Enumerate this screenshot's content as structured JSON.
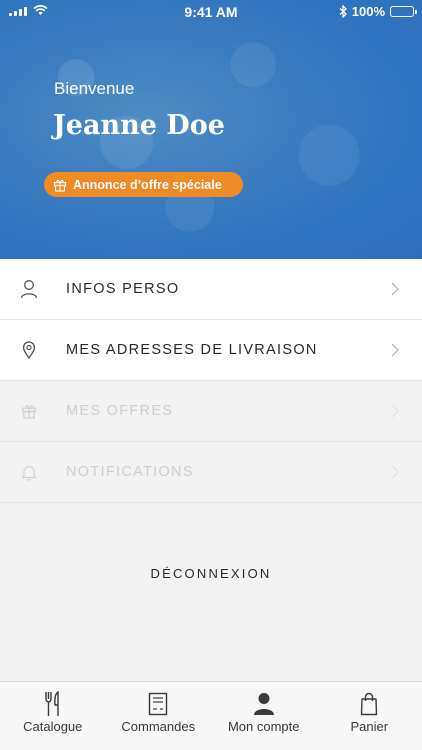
{
  "status_bar": {
    "time": "9:41 AM",
    "battery": "100%"
  },
  "header": {
    "welcome": "Bienvenue",
    "name": "Jeanne Doe",
    "promo_label": "Annonce d’offre spéciale"
  },
  "menu": {
    "items": [
      {
        "label": "INFOS PERSO",
        "icon": "person-icon",
        "enabled": true
      },
      {
        "label": "MES ADRESSES DE LIVRAISON",
        "icon": "location-pin-icon",
        "enabled": true
      },
      {
        "label": "MES OFFRES",
        "icon": "gift-icon",
        "enabled": false
      },
      {
        "label": "NOTIFICATIONS",
        "icon": "bell-icon",
        "enabled": false
      }
    ]
  },
  "logout_label": "DÉCONNEXION",
  "tabbar": {
    "tabs": [
      {
        "label": "Catalogue",
        "icon": "fork-knife-icon"
      },
      {
        "label": "Commandes",
        "icon": "receipt-icon"
      },
      {
        "label": "Mon compte",
        "icon": "user-filled-icon",
        "selected": true
      },
      {
        "label": "Panier",
        "icon": "shopping-bag-icon"
      }
    ]
  },
  "colors": {
    "header_blue": "#2f74c0",
    "promo_orange": "#f08a24"
  }
}
